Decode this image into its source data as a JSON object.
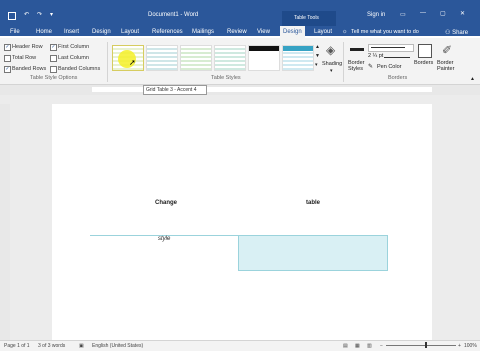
{
  "window": {
    "title": "Document1 - Word",
    "context_title": "Table Tools",
    "signin": "Sign in",
    "share": "Share"
  },
  "ribbon_tabs": [
    "File",
    "Home",
    "Insert",
    "Design",
    "Layout",
    "References",
    "Mailings",
    "Review",
    "View",
    "Design",
    "Layout"
  ],
  "tell_me": "Tell me what you want to do",
  "table_style_options": {
    "items": [
      {
        "label": "Header Row",
        "checked": true
      },
      {
        "label": "First Column",
        "checked": true
      },
      {
        "label": "Total Row",
        "checked": false
      },
      {
        "label": "Last Column",
        "checked": false
      },
      {
        "label": "Banded Rows",
        "checked": true
      },
      {
        "label": "Banded Columns",
        "checked": false
      }
    ],
    "group_label": "Table Style Options"
  },
  "table_styles": {
    "group_label": "Table Styles",
    "tooltip": "Grid Table 3 - Accent 4"
  },
  "shading": {
    "label": "Shading"
  },
  "borders_group": {
    "border_styles": "Border\nStyles",
    "pen_weight": "2 ¼ pt",
    "pen_color": "Pen Color",
    "borders": "Borders",
    "border_painter": "Border\nPainter",
    "group_label": "Borders"
  },
  "document": {
    "word1": "Change",
    "word2": "table",
    "word3": "style"
  },
  "status": {
    "page": "Page 1 of 1",
    "words": "3 of 3 words",
    "language": "English (United States)",
    "zoom": "100%"
  },
  "colors": {
    "accent": "#2b579a",
    "cell": "#d9f0f4"
  }
}
